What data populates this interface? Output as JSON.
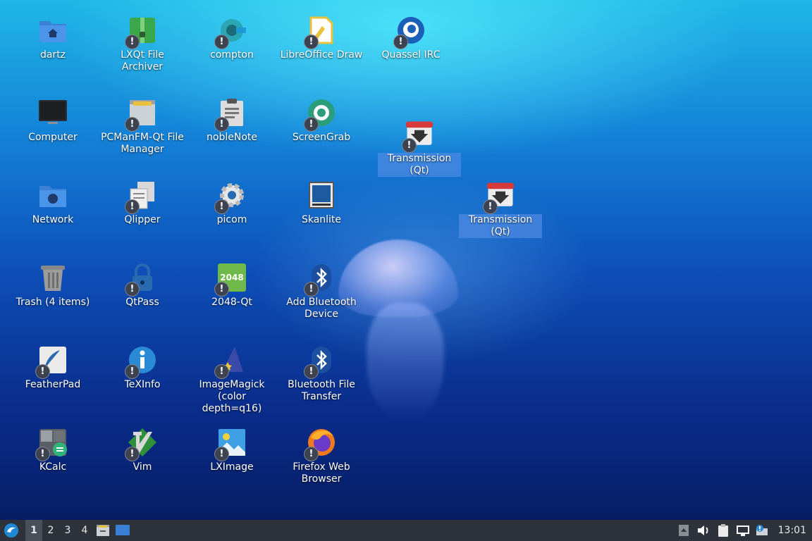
{
  "desktop": {
    "icons": [
      {
        "label": "dartz",
        "icon": "home-folder-icon"
      },
      {
        "label": "LXQt File Archiver",
        "icon": "archive-icon"
      },
      {
        "label": "compton",
        "icon": "compton-icon"
      },
      {
        "label": "LibreOffice Draw",
        "icon": "libreoffice-draw-icon"
      },
      {
        "label": "Quassel IRC",
        "icon": "quassel-icon"
      },
      {
        "label": "Computer",
        "icon": "computer-icon"
      },
      {
        "label": "PCManFM-Qt File Manager",
        "icon": "file-manager-icon"
      },
      {
        "label": "nobleNote",
        "icon": "clipboard-note-icon"
      },
      {
        "label": "ScreenGrab",
        "icon": "camera-shutter-icon"
      },
      {
        "label": "Transmission (Qt)",
        "icon": "transmission-icon"
      },
      {
        "label": "Network",
        "icon": "network-folder-icon"
      },
      {
        "label": "Qlipper",
        "icon": "clipboard-icon"
      },
      {
        "label": "picom",
        "icon": "gear-icon"
      },
      {
        "label": "Skanlite",
        "icon": "scanner-icon"
      },
      {
        "label": "Transmission (Qt)",
        "icon": "transmission-icon"
      },
      {
        "label": "Trash (4 items)",
        "icon": "trash-icon"
      },
      {
        "label": "QtPass",
        "icon": "padlock-icon"
      },
      {
        "label": "2048-Qt",
        "icon": "2048-icon"
      },
      {
        "label": "Add Bluetooth Device",
        "icon": "bluetooth-icon"
      },
      {
        "label": "FeatherPad",
        "icon": "feather-icon"
      },
      {
        "label": "TeXInfo",
        "icon": "info-icon"
      },
      {
        "label": "ImageMagick (color depth=q16)",
        "icon": "wizard-hat-icon"
      },
      {
        "label": "Bluetooth File Transfer",
        "icon": "bluetooth-icon"
      },
      {
        "label": "KCalc",
        "icon": "calculator-icon"
      },
      {
        "label": "Vim",
        "icon": "vim-icon"
      },
      {
        "label": "LXImage",
        "icon": "image-viewer-icon"
      },
      {
        "label": "Firefox Web Browser",
        "icon": "firefox-icon"
      }
    ],
    "warn_glyph": "!",
    "tile_2048_text": "2048"
  },
  "taskbar": {
    "desktops": [
      "1",
      "2",
      "3",
      "4"
    ],
    "active_desktop": "1",
    "clock": "13:01"
  },
  "colors": {
    "taskbar_bg": "#2e333b",
    "selection": "#508ce6",
    "warn_badge": "#3d4350"
  }
}
